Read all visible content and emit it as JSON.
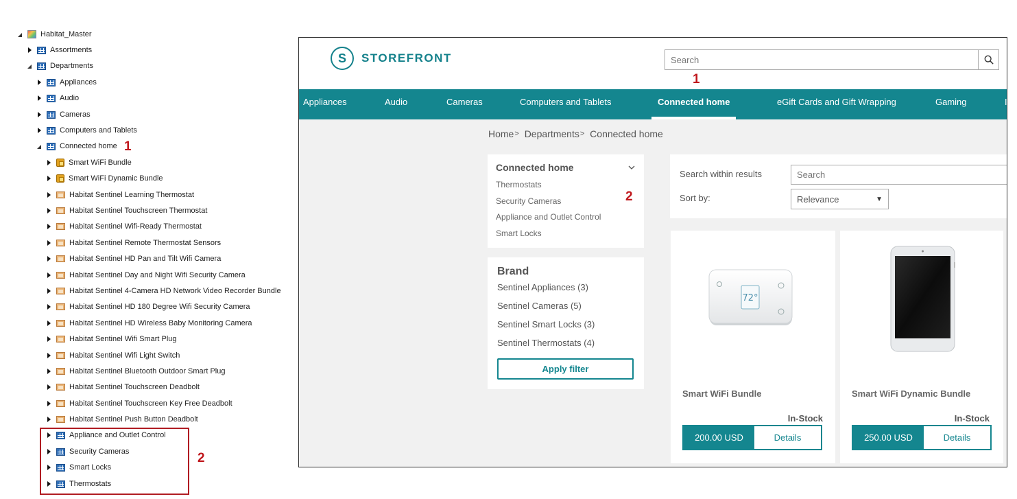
{
  "tree": {
    "root": "Habitat_Master",
    "assortments": "Assortments",
    "departments": "Departments",
    "dept_items": [
      "Appliances",
      "Audio",
      "Cameras",
      "Computers and Tablets"
    ],
    "connected_home": "Connected home",
    "bundles": [
      "Smart WiFi Bundle",
      "Smart WiFi Dynamic Bundle"
    ],
    "products": [
      "Habitat Sentinel Learning Thermostat",
      "Habitat Sentinel Touchscreen Thermostat",
      "Habitat Sentinel Wifi-Ready Thermostat",
      "Habitat Sentinel Remote Thermostat Sensors",
      "Habitat Sentinel HD Pan and Tilt Wifi Camera",
      "Habitat Sentinel Day and Night Wifi Security Camera",
      "Habitat Sentinel 4-Camera HD Network Video Recorder Bundle",
      "Habitat Sentinel HD 180 Degree Wifi Security Camera",
      "Habitat Sentinel HD Wireless Baby Monitoring Camera",
      "Habitat Sentinel Wifi Smart Plug",
      "Habitat Sentinel Wifi Light Switch",
      "Habitat Sentinel Bluetooth Outdoor Smart Plug",
      "Habitat Sentinel Touchscreen Deadbolt",
      "Habitat Sentinel Touchscreen Key Free Deadbolt",
      "Habitat Sentinel Push Button Deadbolt"
    ],
    "subcategories": [
      "Appliance and Outlet Control",
      "Security Cameras",
      "Smart Locks",
      "Thermostats"
    ],
    "marker_1": "1",
    "marker_2": "2"
  },
  "store": {
    "logo_text": "STOREFRONT",
    "logo_glyph": "S",
    "search_placeholder": "Search",
    "nav": [
      "Appliances",
      "Audio",
      "Cameras",
      "Computers and Tablets",
      "Connected home",
      "eGift Cards and Gift Wrapping",
      "Gaming",
      "I"
    ],
    "active_nav": "Connected home",
    "breadcrumb": [
      "Home",
      "Departments",
      "Connected home"
    ],
    "breadcrumb_sep": ">",
    "category_panel": {
      "title": "Connected home",
      "links": [
        "Thermostats",
        "Security Cameras",
        "Appliance and Outlet Control",
        "Smart Locks"
      ]
    },
    "brand_panel": {
      "title": "Brand",
      "items": [
        "Sentinel Appliances (3)",
        "Sentinel Cameras (5)",
        "Sentinel Smart Locks (3)",
        "Sentinel Thermostats (4)"
      ],
      "apply_label": "Apply filter"
    },
    "filter": {
      "search_within_label": "Search within results",
      "search_within_placeholder": "Search",
      "sort_label": "Sort by:",
      "sort_value": "Relevance"
    },
    "products": [
      {
        "name": "Smart WiFi Bundle",
        "stock": "In-Stock",
        "price": "200.00 USD",
        "details": "Details",
        "thermostat_reading": "72°"
      },
      {
        "name": "Smart WiFi Dynamic Bundle",
        "stock": "In-Stock",
        "price": "250.00 USD",
        "details": "Details"
      }
    ],
    "marker_1": "1",
    "marker_2": "2"
  },
  "colors": {
    "teal": "#14868f",
    "marker_red": "#c0181d"
  }
}
